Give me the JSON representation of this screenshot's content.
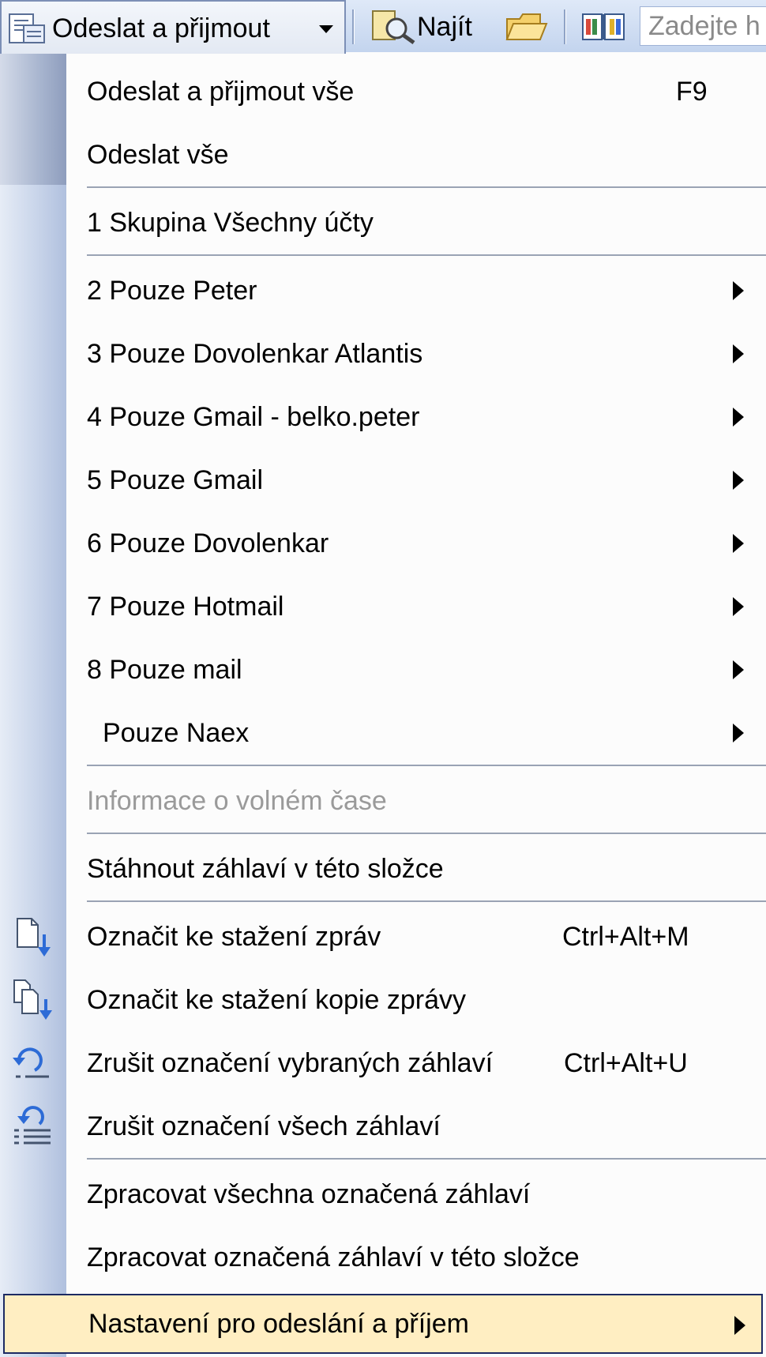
{
  "toolbar": {
    "send_receive_label": "Odeslat a přijmout",
    "find_label": "Najít",
    "search_placeholder": "Zadejte h"
  },
  "menu": {
    "items": [
      {
        "label": "Odeslat a přijmout vše",
        "shortcut": "F9"
      },
      {
        "label": "Odeslat vše"
      },
      {
        "label": "1 Skupina Všechny účty"
      },
      {
        "label": "2 Pouze Peter"
      },
      {
        "label": "3 Pouze Dovolenkar Atlantis"
      },
      {
        "label": "4 Pouze Gmail - belko.peter"
      },
      {
        "label": "5 Pouze Gmail"
      },
      {
        "label": "6 Pouze Dovolenkar"
      },
      {
        "label": "7 Pouze Hotmail"
      },
      {
        "label": "8 Pouze mail"
      },
      {
        "label": "Pouze Naex"
      },
      {
        "label": "Informace o volném čase",
        "disabled": true
      },
      {
        "label": "Stáhnout záhlaví v této složce"
      },
      {
        "label": "Označit ke stažení zpráv",
        "shortcut": "Ctrl+Alt+M"
      },
      {
        "label": "Označit ke stažení kopie zprávy"
      },
      {
        "label": "Zrušit označení vybraných záhlaví",
        "shortcut": "Ctrl+Alt+U"
      },
      {
        "label": "Zrušit označení všech záhlaví"
      },
      {
        "label": "Zpracovat všechna označená záhlaví"
      },
      {
        "label": "Zpracovat označená záhlaví v této složce"
      },
      {
        "label": "Nastavení pro odeslání a příjem",
        "highlighted": true
      }
    ]
  },
  "icons": {
    "send_receive": "send-receive-icon",
    "find": "find-icon",
    "folder": "folder-icon",
    "address_book": "address-book-icon",
    "mark_download": "mark-download-icon",
    "mark_copy": "mark-copy-icon",
    "unmark_selected": "unmark-selected-icon",
    "unmark_all": "unmark-all-icon"
  },
  "colors": {
    "highlight_bg": "#ffeec2",
    "highlight_border": "#1c2a63",
    "gutter": "#c9d5ea",
    "disabled_text": "#9a9a9a"
  }
}
